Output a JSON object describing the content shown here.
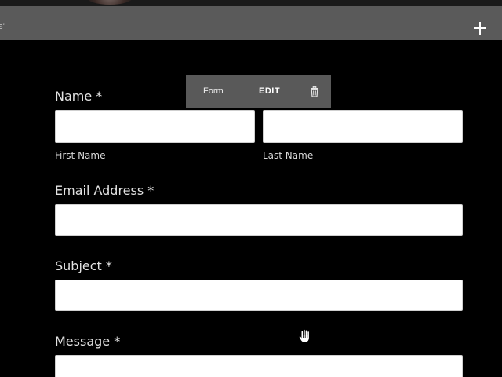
{
  "header": {
    "breadcrumb_fragment": "s'",
    "add_label": "+"
  },
  "block_toolbar": {
    "type_label": "Form",
    "edit_label": "EDIT",
    "delete_icon": "trash-icon"
  },
  "form": {
    "name": {
      "label": "Name *",
      "first_name_value": "",
      "last_name_value": "",
      "first_name_sublabel": "First Name",
      "last_name_sublabel": "Last Name"
    },
    "email": {
      "label": "Email Address *",
      "value": ""
    },
    "subject": {
      "label": "Subject *",
      "value": ""
    },
    "message": {
      "label": "Message *",
      "value": ""
    }
  },
  "cursor": "hand-cursor-icon",
  "colors": {
    "background": "#000000",
    "band": "#5a5a5a",
    "popover": "#595959",
    "label_text": "#e2e2e2",
    "input_bg": "#ffffff"
  }
}
